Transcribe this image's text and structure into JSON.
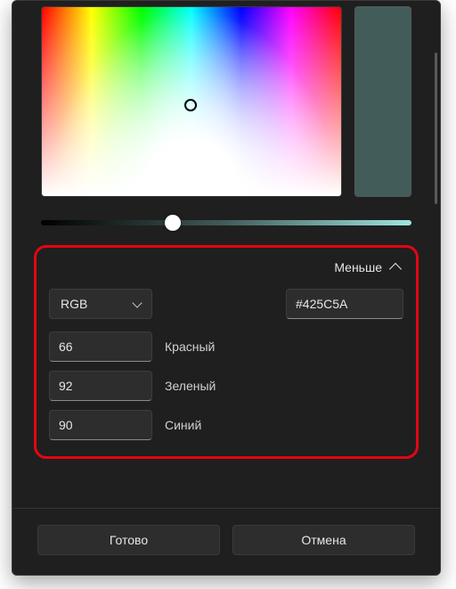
{
  "swatch_color": "#425C5A",
  "slider_gradient": "linear-gradient(to right,#000 0%,#425C5A 50%,#9fe6df 100%)",
  "less_label": "Меньше",
  "mode_selected": "RGB",
  "hex_value": "#425C5A",
  "channels": [
    {
      "value": "66",
      "label": "Красный"
    },
    {
      "value": "92",
      "label": "Зеленый"
    },
    {
      "value": "90",
      "label": "Синий"
    }
  ],
  "footer": {
    "ok": "Готово",
    "cancel": "Отмена"
  }
}
